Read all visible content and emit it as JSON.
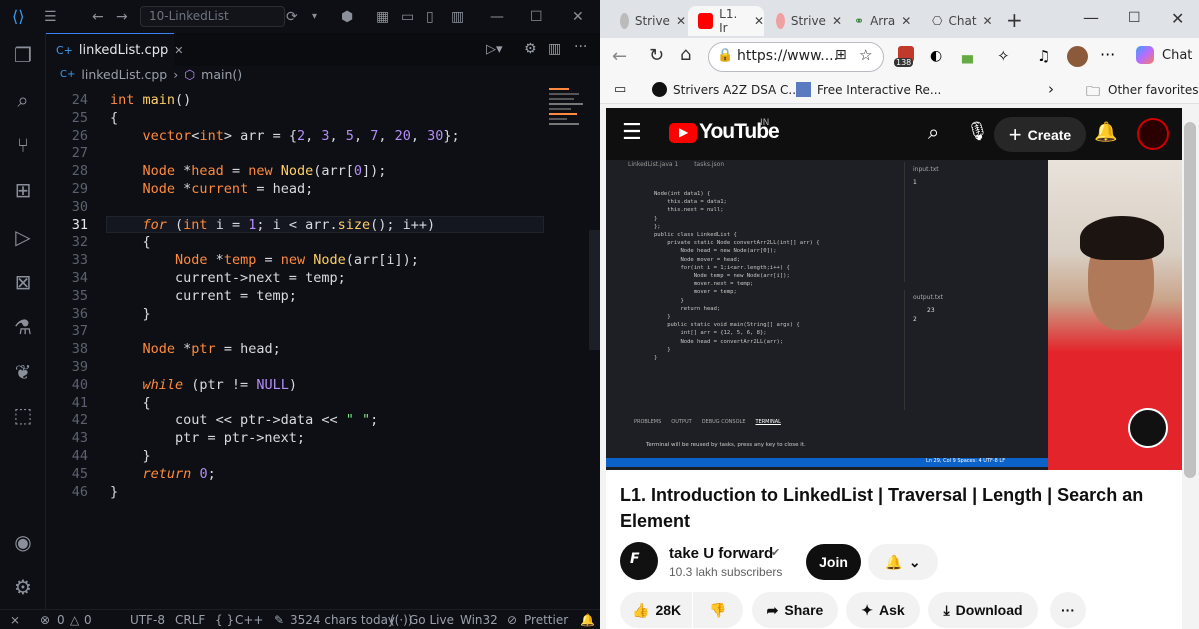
{
  "editor": {
    "workspace": "10-LinkedList",
    "tab_label": "linkedList.cpp",
    "breadcrumb_file": "linkedList.cpp",
    "breadcrumb_symbol": "main()",
    "lines": [
      {
        "n": "24",
        "parts": [
          [
            "t",
            "int"
          ],
          [
            "x",
            " "
          ],
          [
            "f",
            "main"
          ],
          [
            "x",
            "()"
          ]
        ]
      },
      {
        "n": "25",
        "parts": [
          [
            "x",
            "{"
          ]
        ]
      },
      {
        "n": "26",
        "parts": [
          [
            "x",
            "    "
          ],
          [
            "t",
            "vector"
          ],
          [
            "x",
            "<"
          ],
          [
            "t",
            "int"
          ],
          [
            "x",
            "> arr = {"
          ],
          [
            "n",
            "2"
          ],
          [
            "x",
            ", "
          ],
          [
            "n",
            "3"
          ],
          [
            "x",
            ", "
          ],
          [
            "n",
            "5"
          ],
          [
            "x",
            ", "
          ],
          [
            "n",
            "7"
          ],
          [
            "x",
            ", "
          ],
          [
            "n",
            "20"
          ],
          [
            "x",
            ", "
          ],
          [
            "n",
            "30"
          ],
          [
            "x",
            "};"
          ]
        ]
      },
      {
        "n": "27",
        "parts": []
      },
      {
        "n": "28",
        "parts": [
          [
            "x",
            "    "
          ],
          [
            "t",
            "Node"
          ],
          [
            "x",
            " *"
          ],
          [
            "k",
            "head"
          ],
          [
            "x",
            " = "
          ],
          [
            "k",
            "new"
          ],
          [
            "x",
            " "
          ],
          [
            "f",
            "Node"
          ],
          [
            "x",
            "(arr["
          ],
          [
            "n",
            "0"
          ],
          [
            "x",
            "]);"
          ]
        ]
      },
      {
        "n": "29",
        "parts": [
          [
            "x",
            "    "
          ],
          [
            "t",
            "Node"
          ],
          [
            "x",
            " *"
          ],
          [
            "k",
            "current"
          ],
          [
            "x",
            " = head;"
          ]
        ]
      },
      {
        "n": "30",
        "parts": []
      },
      {
        "n": "31",
        "parts": [
          [
            "x",
            "    "
          ],
          [
            "i",
            "for"
          ],
          [
            "x",
            " ("
          ],
          [
            "t",
            "int"
          ],
          [
            "x",
            " i = "
          ],
          [
            "n",
            "1"
          ],
          [
            "x",
            "; i < arr."
          ],
          [
            "f",
            "size"
          ],
          [
            "x",
            "(); i++)"
          ]
        ]
      },
      {
        "n": "32",
        "parts": [
          [
            "x",
            "    {"
          ]
        ]
      },
      {
        "n": "33",
        "parts": [
          [
            "x",
            "        "
          ],
          [
            "t",
            "Node"
          ],
          [
            "x",
            " *"
          ],
          [
            "k",
            "temp"
          ],
          [
            "x",
            " = "
          ],
          [
            "k",
            "new"
          ],
          [
            "x",
            " "
          ],
          [
            "f",
            "Node"
          ],
          [
            "x",
            "(arr[i]);"
          ]
        ]
      },
      {
        "n": "34",
        "parts": [
          [
            "x",
            "        current->next = temp;"
          ]
        ]
      },
      {
        "n": "35",
        "parts": [
          [
            "x",
            "        current = temp;"
          ]
        ]
      },
      {
        "n": "36",
        "parts": [
          [
            "x",
            "    }"
          ]
        ]
      },
      {
        "n": "37",
        "parts": []
      },
      {
        "n": "38",
        "parts": [
          [
            "x",
            "    "
          ],
          [
            "t",
            "Node"
          ],
          [
            "x",
            " *"
          ],
          [
            "k",
            "ptr"
          ],
          [
            "x",
            " = head;"
          ]
        ]
      },
      {
        "n": "39",
        "parts": []
      },
      {
        "n": "40",
        "parts": [
          [
            "x",
            "    "
          ],
          [
            "i",
            "while"
          ],
          [
            "x",
            " (ptr != "
          ],
          [
            "n",
            "NULL"
          ],
          [
            "x",
            ")"
          ]
        ]
      },
      {
        "n": "41",
        "parts": [
          [
            "x",
            "    {"
          ]
        ]
      },
      {
        "n": "42",
        "parts": [
          [
            "x",
            "        cout << ptr->data << "
          ],
          [
            "s",
            "\" \""
          ],
          [
            "x",
            ";"
          ]
        ]
      },
      {
        "n": "43",
        "parts": [
          [
            "x",
            "        ptr = ptr->next;"
          ]
        ]
      },
      {
        "n": "44",
        "parts": [
          [
            "x",
            "    }"
          ]
        ]
      },
      {
        "n": "45",
        "parts": [
          [
            "x",
            "    "
          ],
          [
            "i",
            "return"
          ],
          [
            "x",
            " "
          ],
          [
            "n",
            "0"
          ],
          [
            "x",
            ";"
          ]
        ]
      },
      {
        "n": "46",
        "parts": [
          [
            "x",
            "}"
          ]
        ]
      }
    ],
    "status": {
      "errors": "0",
      "warnings": "0",
      "encoding": "UTF-8",
      "eol": "CRLF",
      "language": "C++",
      "chars": "3524 chars today",
      "golive": "Go Live",
      "platform": "Win32",
      "prettier": "Prettier"
    }
  },
  "browser": {
    "tabs": [
      {
        "label": "Strive",
        "color": "#e0e0e0"
      },
      {
        "label": "L1. Ir",
        "color": "#ff0000"
      },
      {
        "label": "Strive",
        "color": "#e0e0e0"
      },
      {
        "label": "Arra",
        "color": "#e0e0e0"
      },
      {
        "label": "Chat",
        "color": "#e0e0e0"
      }
    ],
    "url": "https://www....",
    "bookmarks": [
      {
        "label": "Strivers A2Z DSA C..."
      },
      {
        "label": "Free Interactive Re..."
      }
    ],
    "other_favorites": "Other favorites",
    "copilot_label": "Chat",
    "extension_badge": "138"
  },
  "youtube": {
    "logo": "YouTube",
    "region": "IN",
    "create_label": "Create",
    "video_title": "L1. Introduction to LinkedList | Traversal | Length | Search an Element",
    "channel": "take U forward",
    "subscribers": "10.3 lakh subscribers",
    "join_label": "Join",
    "likes": "28K",
    "share_label": "Share",
    "ask_label": "Ask",
    "download_label": "Download",
    "video_inner": {
      "tab1": "LinkedList.java 1",
      "tab2": "tasks.json",
      "input_label": "input.txt",
      "input_value": "1",
      "output_label": "output.txt",
      "output_values": [
        "23",
        "2"
      ],
      "terminal_msg": "Terminal will be reused by tasks, press any key to close it.",
      "status": "Ln 29, Col 9   Spaces: 4   UTF-8   LF",
      "panel_tabs": [
        "PROBLEMS",
        "OUTPUT",
        "DEBUG CONSOLE",
        "TERMINAL"
      ],
      "code": [
        "Node(int data1) {",
        "    this.data = data1;",
        "    this.next = null;",
        "}",
        "};",
        "public class LinkedList {",
        "    private static Node convertArr2LL(int[] arr) {",
        "        Node head = new Node(arr[0]);",
        "        Node mover = head;",
        "        for(int i = 1;i<arr.length;i++) {",
        "            Node temp = new Node(arr[i]);",
        "            mover.next = temp;",
        "            mover = temp;",
        "        }",
        "        return head;",
        "    }",
        "    public static void main(String[] args) {",
        "        int[] arr = {12, 5, 6, 8};",
        "        Node head = convertArr2LL(arr);",
        "    }",
        "}"
      ]
    }
  }
}
